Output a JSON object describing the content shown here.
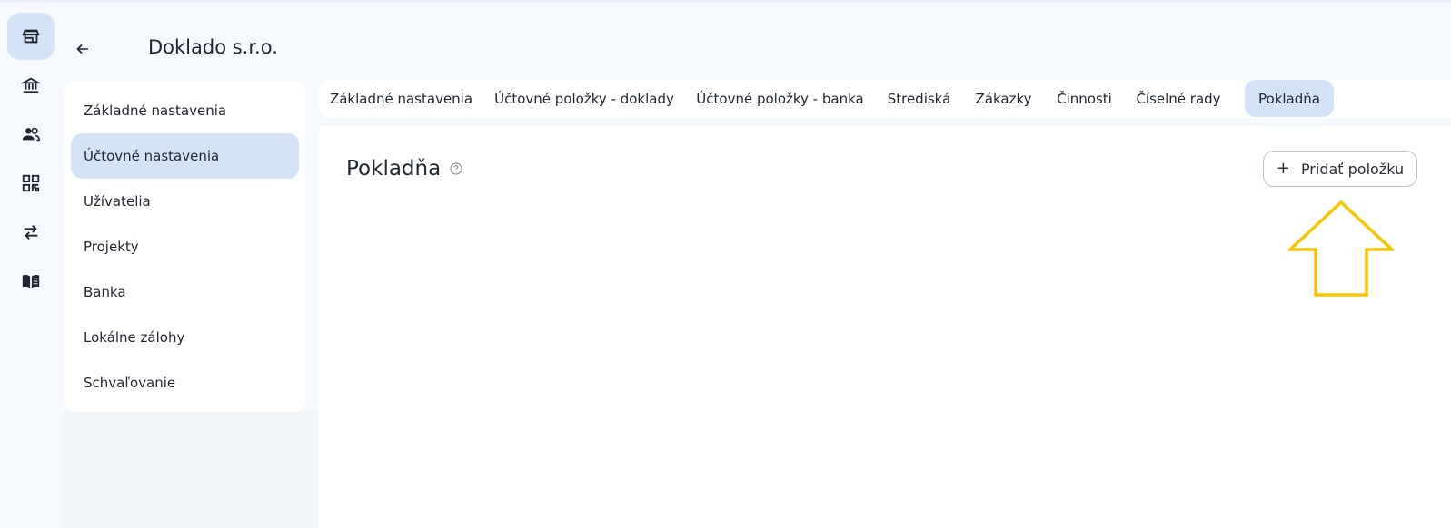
{
  "header": {
    "company": "Doklado s.r.o."
  },
  "rail": {
    "items": [
      {
        "icon": "store-icon"
      },
      {
        "icon": "bank-icon"
      },
      {
        "icon": "people-icon"
      },
      {
        "icon": "qr-code-icon"
      },
      {
        "icon": "swap-icon"
      },
      {
        "icon": "book-icon"
      }
    ]
  },
  "settings_menu": {
    "items": [
      {
        "label": "Základné nastavenia"
      },
      {
        "label": "Účtovné nastavenia"
      },
      {
        "label": "Užívatelia"
      },
      {
        "label": "Projekty"
      },
      {
        "label": "Banka"
      },
      {
        "label": "Lokálne zálohy"
      },
      {
        "label": "Schvaľovanie"
      }
    ],
    "active": "Účtovné nastavenia"
  },
  "tabs": {
    "items": [
      {
        "label": "Základné nastavenia"
      },
      {
        "label": "Účtovné položky - doklady"
      },
      {
        "label": "Účtovné položky - banka"
      },
      {
        "label": "Strediská"
      },
      {
        "label": "Zákazky"
      },
      {
        "label": "Činnosti"
      },
      {
        "label": "Číselné rady"
      },
      {
        "label": "Pokladňa"
      }
    ],
    "active": "Pokladňa"
  },
  "content": {
    "title": "Pokladňa",
    "add_button_label": "Pridať položku"
  },
  "colors": {
    "accent_bg": "#d5e3f8",
    "annotation_arrow": "#f7c400",
    "page_bg": "#f5f8fc"
  }
}
